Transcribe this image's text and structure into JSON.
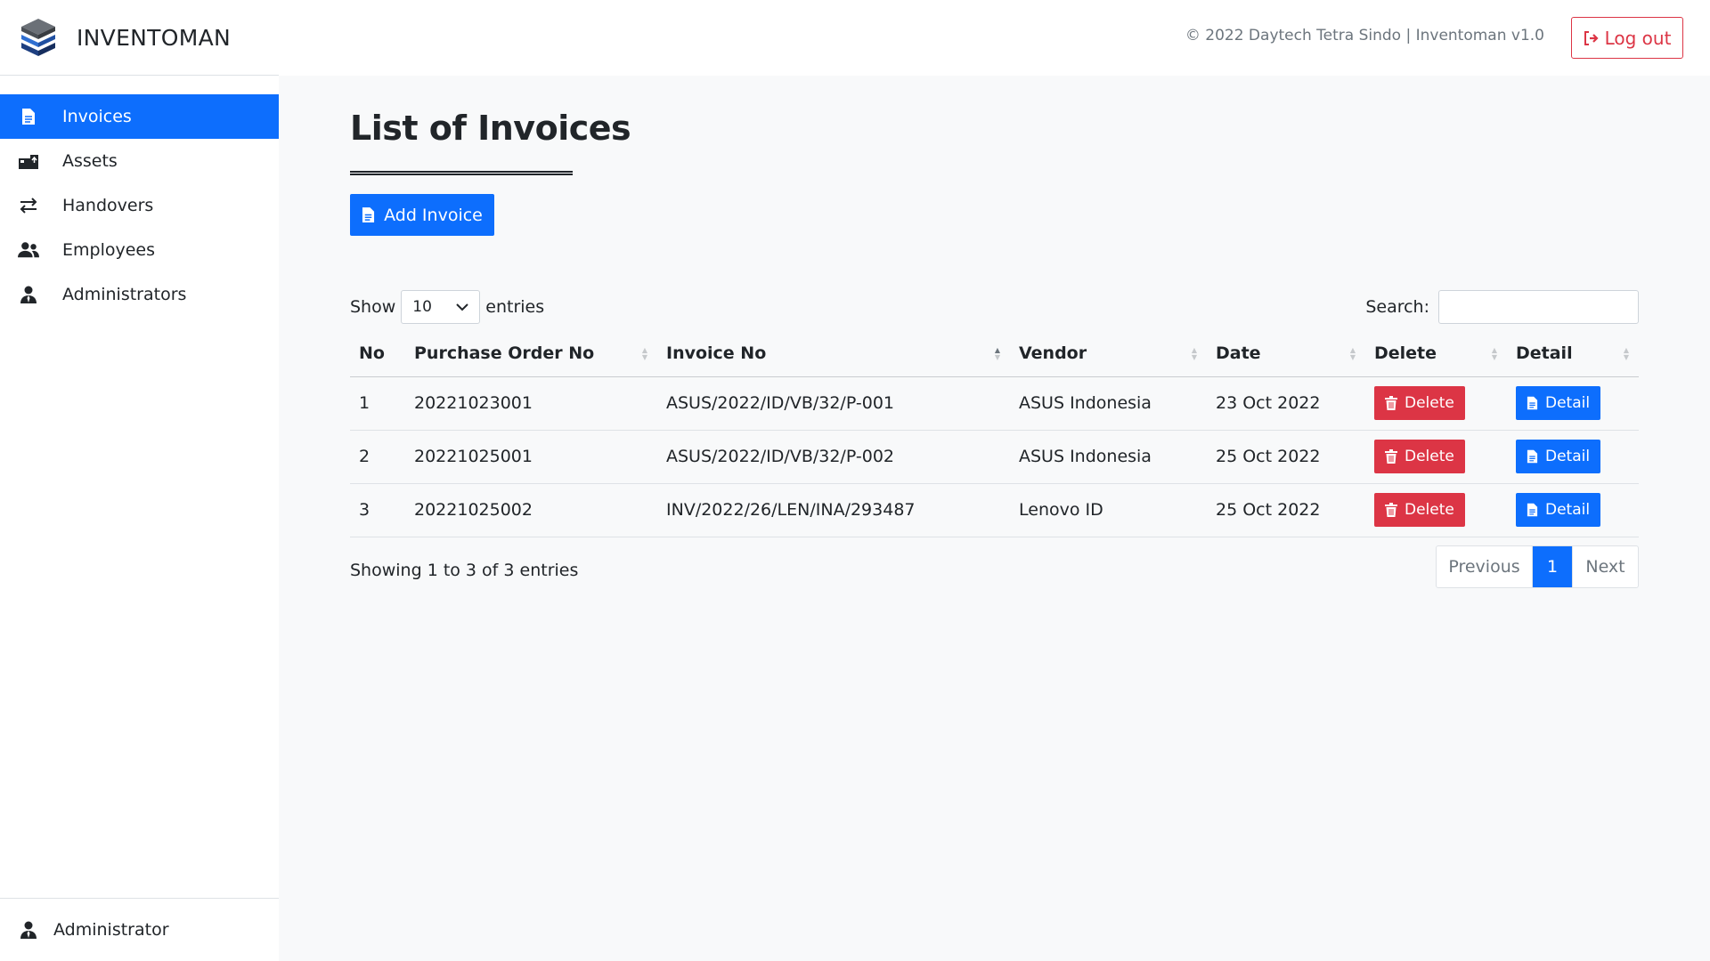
{
  "header": {
    "app_name": "INVENTOMAN",
    "copyright": "© 2022 Daytech Tetra Sindo | Inventoman v1.0",
    "logout_label": "Log out"
  },
  "sidebar": {
    "items": [
      {
        "label": "Invoices",
        "icon": "file-icon",
        "active": true
      },
      {
        "label": "Assets",
        "icon": "assets-icon",
        "active": false
      },
      {
        "label": "Handovers",
        "icon": "exchange-icon",
        "active": false
      },
      {
        "label": "Employees",
        "icon": "users-icon",
        "active": false
      },
      {
        "label": "Administrators",
        "icon": "admin-icon",
        "active": false
      }
    ],
    "footer_user": "Administrator"
  },
  "main": {
    "title": "List of Invoices",
    "add_button": "Add Invoice",
    "show_label": "Show",
    "entries_value": "10",
    "entries_label": "entries",
    "search_label": "Search:",
    "search_value": "",
    "columns": [
      "No",
      "Purchase Order No",
      "Invoice No",
      "Vendor",
      "Date",
      "Delete",
      "Detail"
    ],
    "rows": [
      {
        "no": "1",
        "po": "20221023001",
        "invoice": "ASUS/2022/ID/VB/32/P-001",
        "vendor": "ASUS Indonesia",
        "date": "23 Oct 2022",
        "delete": "Delete",
        "detail": "Detail"
      },
      {
        "no": "2",
        "po": "20221025001",
        "invoice": "ASUS/2022/ID/VB/32/P-002",
        "vendor": "ASUS Indonesia",
        "date": "25 Oct 2022",
        "delete": "Delete",
        "detail": "Detail"
      },
      {
        "no": "3",
        "po": "20221025002",
        "invoice": "INV/2022/26/LEN/INA/293487",
        "vendor": "Lenovo ID",
        "date": "25 Oct 2022",
        "delete": "Delete",
        "detail": "Detail"
      }
    ],
    "info": "Showing 1 to 3 of 3 entries",
    "pagination": {
      "previous": "Previous",
      "current": "1",
      "next": "Next"
    }
  },
  "colors": {
    "primary": "#0d6efd",
    "danger": "#dc3545",
    "background": "#f8f9fa"
  }
}
